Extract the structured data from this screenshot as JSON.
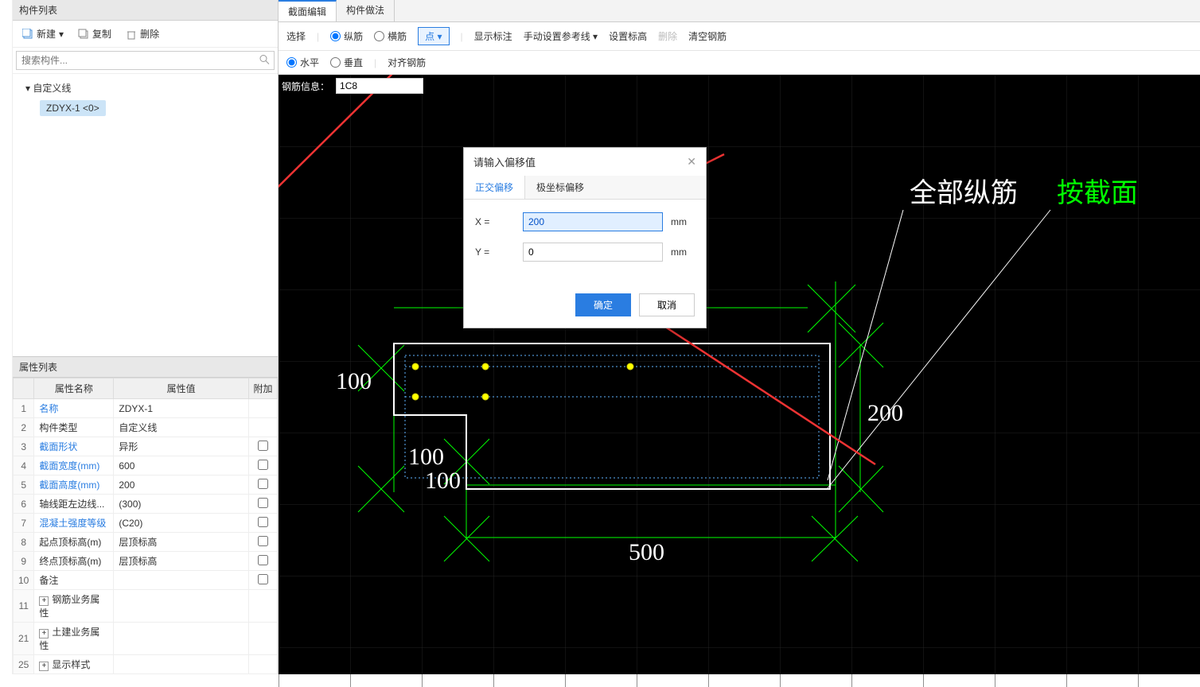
{
  "left": {
    "title": "构件列表",
    "new_btn": "新建",
    "copy_btn": "复制",
    "del_btn": "删除",
    "search_placeholder": "搜索构件...",
    "tree_root": "自定义线",
    "tree_item": "ZDYX-1 <0>",
    "prop_title": "属性列表",
    "headers": {
      "name": "属性名称",
      "val": "属性值",
      "extra": "附加"
    },
    "rows": [
      {
        "n": "1",
        "name": "名称",
        "link": true,
        "val": "ZDYX-1",
        "chk": null
      },
      {
        "n": "2",
        "name": "构件类型",
        "link": false,
        "val": "自定义线",
        "chk": null
      },
      {
        "n": "3",
        "name": "截面形状",
        "link": true,
        "val": "异形",
        "chk": false
      },
      {
        "n": "4",
        "name": "截面宽度(mm)",
        "link": true,
        "val": "600",
        "chk": false
      },
      {
        "n": "5",
        "name": "截面高度(mm)",
        "link": true,
        "val": "200",
        "chk": false
      },
      {
        "n": "6",
        "name": "轴线距左边线...",
        "link": false,
        "val": "(300)",
        "chk": false
      },
      {
        "n": "7",
        "name": "混凝土强度等级",
        "link": true,
        "val": "(C20)",
        "chk": false
      },
      {
        "n": "8",
        "name": "起点顶标高(m)",
        "link": false,
        "val": "层顶标高",
        "chk": false
      },
      {
        "n": "9",
        "name": "终点顶标高(m)",
        "link": false,
        "val": "层顶标高",
        "chk": false
      },
      {
        "n": "10",
        "name": "备注",
        "link": false,
        "val": "",
        "chk": false
      },
      {
        "n": "11",
        "name": "钢筋业务属性",
        "link": false,
        "val": "",
        "chk": null,
        "exp": true
      },
      {
        "n": "21",
        "name": "土建业务属性",
        "link": false,
        "val": "",
        "chk": null,
        "exp": true
      },
      {
        "n": "25",
        "name": "显示样式",
        "link": false,
        "val": "",
        "chk": null,
        "exp": true
      }
    ]
  },
  "top": {
    "tabs": [
      "截面编辑",
      "构件做法"
    ],
    "row1": {
      "select": "选择",
      "zong": "纵筋",
      "heng": "横筋",
      "point": "点",
      "show": "显示标注",
      "manual": "手动设置参考线",
      "elev": "设置标高",
      "del": "删除",
      "clear": "清空钢筋"
    },
    "row2": {
      "hor": "水平",
      "ver": "垂直",
      "align": "对齐钢筋"
    },
    "info_label": "钢筋信息：",
    "info_val": "1C8"
  },
  "dialog": {
    "title": "请输入偏移值",
    "tabs": [
      "正交偏移",
      "极坐标偏移"
    ],
    "x_label": "X =",
    "x_val": "200",
    "x_unit": "mm",
    "y_label": "Y =",
    "y_val": "0",
    "y_unit": "mm",
    "ok": "确定",
    "cancel": "取消"
  },
  "canvas": {
    "dims": {
      "h100": "100",
      "w100a": "100",
      "w100b": "100",
      "w500": "500",
      "h200": "200"
    },
    "anno1": "全部纵筋",
    "anno2": "按截面"
  }
}
